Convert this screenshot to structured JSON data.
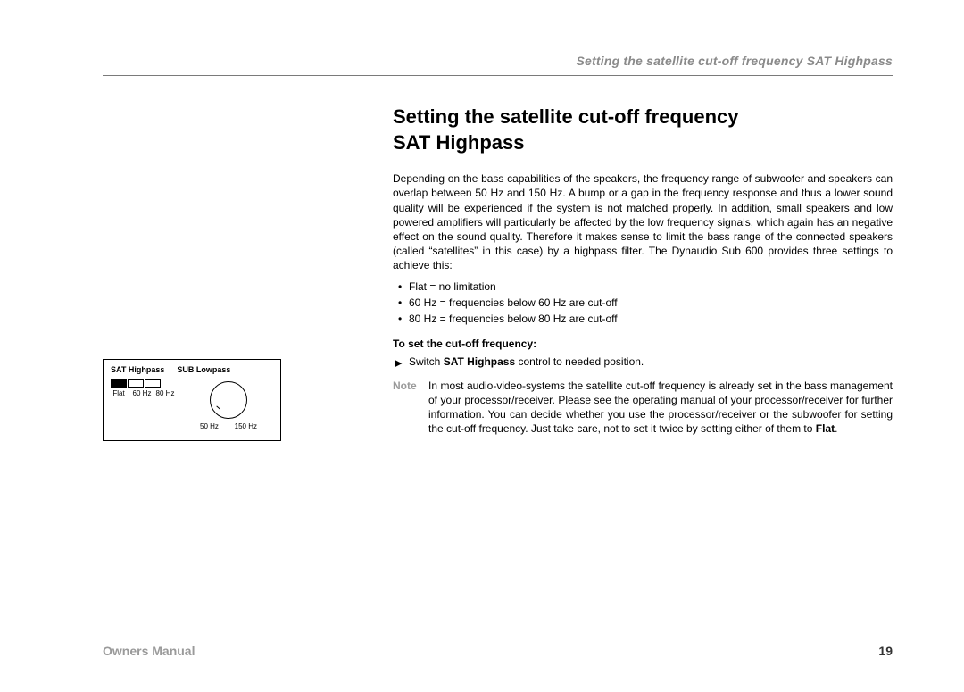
{
  "header": {
    "top_right_title": "Setting the satellite cut-off frequency SAT Highpass"
  },
  "main": {
    "heading_line1": "Setting the satellite cut-off frequency",
    "heading_line2": "SAT Highpass",
    "intro_para": "Depending on the bass capabilities of the speakers, the frequency range of subwoofer and speakers can overlap between 50 Hz and 150 Hz. A bump or a gap in the frequency response and thus a lower sound quality will be experienced if the system is not matched properly. In addition, small speakers and low powered amplifiers will particularly be affected by the low frequency signals, which again has an negative effect on the sound quality. Therefore it makes sense to limit the bass range of the connected speakers (called “satellites” in this case) by a highpass filter. The Dynaudio Sub 600 provides three settings to achieve this:",
    "bullets": [
      "Flat = no limitation",
      "60 Hz = frequencies below 60 Hz are cut-off",
      "80 Hz = frequencies below 80 Hz are cut-off"
    ],
    "subheading": "To set the cut-off frequency:",
    "step_pre": "Switch ",
    "step_bold": "SAT Highpass",
    "step_post": " control to needed position.",
    "note_label": "Note",
    "note_pre": "In most audio-video-systems the satellite cut-off frequency is already set in the bass management of your processor/receiver. Please see the operating manual of your processor/receiver for further information. You can decide whether you use the processor/receiver or the subwoofer for setting the cut-off frequency. Just take care, not to set it twice by setting either of them to ",
    "note_bold": "Flat",
    "note_post": "."
  },
  "diagram": {
    "label_sat": "SAT Highpass",
    "label_sub": "SUB Lowpass",
    "sw1": "Flat",
    "sw2": "60 Hz",
    "sw3": "80 Hz",
    "knob_low": "50 Hz",
    "knob_high": "150 Hz"
  },
  "footer": {
    "label": "Owners Manual",
    "page": "19"
  }
}
